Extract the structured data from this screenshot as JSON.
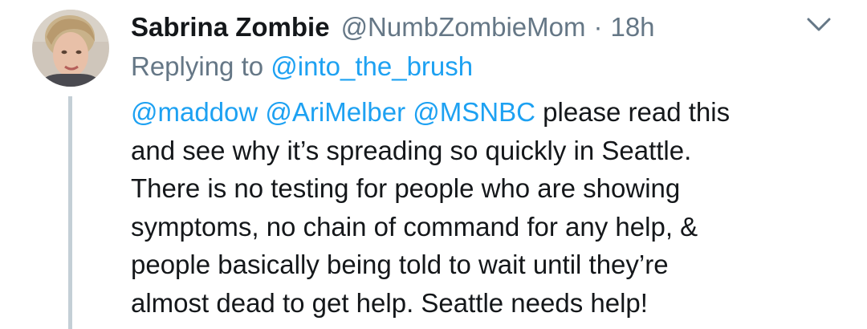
{
  "tweet": {
    "author": {
      "display_name": "Sabrina Zombie",
      "handle": "@NumbZombieMom",
      "avatar": "profile-photo"
    },
    "separator": "·",
    "time": "18h",
    "menu_icon": "chevron-down-icon",
    "replying": {
      "prefix": "Replying to",
      "to": "@into_the_brush"
    },
    "mentions": [
      "@maddow",
      "@AriMelber",
      "@MSNBC"
    ],
    "lines": [
      " please read this",
      "and see why it’s spreading so quickly in Seattle.",
      "There is no testing for people who are showing",
      "symptoms, no chain of command for any help, &",
      "people basically being told to wait until they’re",
      "almost dead to get help. Seattle needs help!"
    ],
    "colors": {
      "link": "#1da1f2",
      "secondary_text": "#657786",
      "primary_text": "#14171a",
      "thread_line": "#c4cfd6"
    }
  }
}
